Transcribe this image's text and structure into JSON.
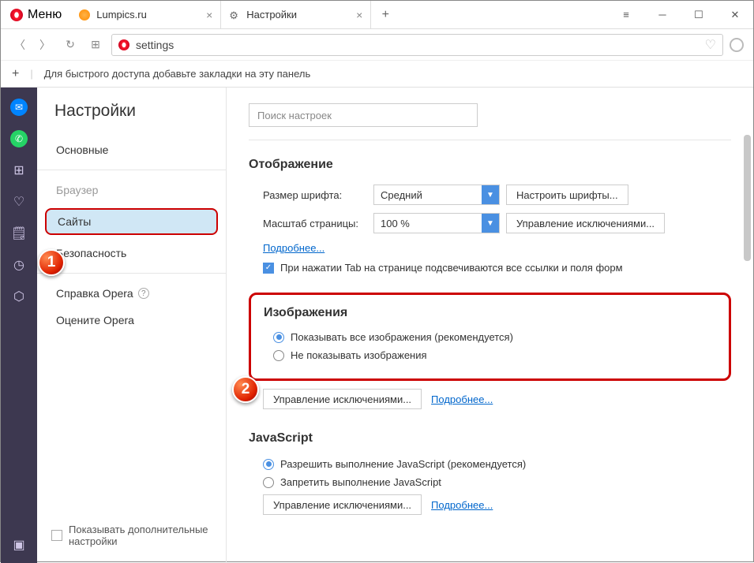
{
  "titlebar": {
    "menu_label": "Меню",
    "tabs": [
      {
        "label": "Lumpics.ru"
      },
      {
        "label": "Настройки"
      }
    ]
  },
  "addressbar": {
    "url": "settings"
  },
  "bookmarks_bar": {
    "hint": "Для быстрого доступа добавьте закладки на эту панель"
  },
  "settings": {
    "title": "Настройки",
    "nav": {
      "basic": "Основные",
      "browser": "Браузер",
      "sites": "Сайты",
      "security": "Безопасность",
      "help": "Справка Opera",
      "rate": "Оцените Opera"
    },
    "advanced_checkbox": "Показывать дополнительные настройки",
    "search_placeholder": "Поиск настроек"
  },
  "display": {
    "heading": "Отображение",
    "font_size_label": "Размер шрифта:",
    "font_size_value": "Средний",
    "configure_fonts_btn": "Настроить шрифты...",
    "page_zoom_label": "Масштаб страницы:",
    "page_zoom_value": "100 %",
    "manage_exceptions_btn": "Управление исключениями...",
    "more_link": "Подробнее...",
    "tab_highlight": "При нажатии Tab на странице подсвечиваются все ссылки и поля форм"
  },
  "images": {
    "heading": "Изображения",
    "show_all": "Показывать все изображения (рекомендуется)",
    "dont_show": "Не показывать изображения",
    "manage_exceptions_btn": "Управление исключениями...",
    "more_link": "Подробнее..."
  },
  "javascript": {
    "heading": "JavaScript",
    "allow": "Разрешить выполнение JavaScript (рекомендуется)",
    "block": "Запретить выполнение JavaScript",
    "manage_exceptions_btn": "Управление исключениями...",
    "more_link": "Подробнее..."
  },
  "badges": {
    "1": "1",
    "2": "2"
  }
}
